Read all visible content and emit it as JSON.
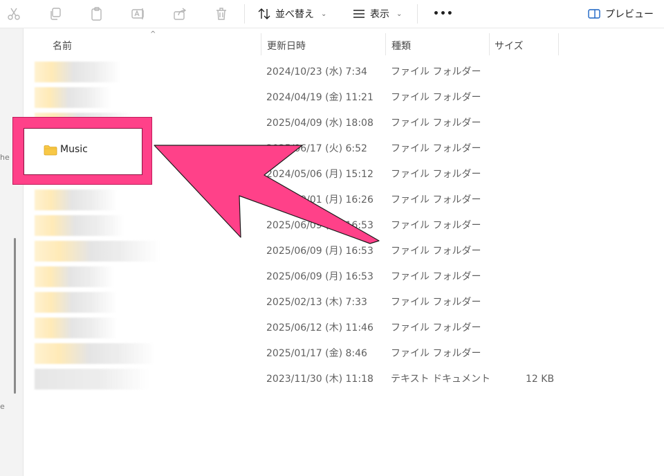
{
  "toolbar": {
    "sort_label": "並べ替え",
    "view_label": "表示",
    "more_label": "•••",
    "preview_label": "プレビュー"
  },
  "headers": {
    "name": "名前",
    "date": "更新日時",
    "type": "種類",
    "size": "サイズ"
  },
  "rows": [
    {
      "date": "2024/10/23 (水) 7:34",
      "type": "ファイル フォルダー",
      "size": ""
    },
    {
      "date": "2024/04/19 (金) 11:21",
      "type": "ファイル フォルダー",
      "size": ""
    },
    {
      "date": "2025/04/09 (水) 18:08",
      "type": "ファイル フォルダー",
      "size": ""
    },
    {
      "date": "2025/06/17 (火) 6:52",
      "type": "ファイル フォルダー",
      "size": ""
    },
    {
      "date": "2024/05/06 (月) 15:12",
      "type": "ファイル フォルダー",
      "size": ""
    },
    {
      "date": "2024/09/01 (月) 16:26",
      "type": "ファイル フォルダー",
      "size": ""
    },
    {
      "date": "2025/06/09 (月) 16:53",
      "type": "ファイル フォルダー",
      "size": ""
    },
    {
      "date": "2025/06/09 (月) 16:53",
      "type": "ファイル フォルダー",
      "size": ""
    },
    {
      "date": "2025/06/09 (月) 16:53",
      "type": "ファイル フォルダー",
      "size": ""
    },
    {
      "date": "2025/02/13 (木) 7:33",
      "type": "ファイル フォルダー",
      "size": ""
    },
    {
      "date": "2025/06/12 (木) 11:46",
      "type": "ファイル フォルダー",
      "size": ""
    },
    {
      "date": "2025/01/17 (金) 8:46",
      "type": "ファイル フォルダー",
      "size": ""
    },
    {
      "date": "2023/11/30 (木) 11:18",
      "type": "テキスト ドキュメント",
      "size": "12 KB"
    }
  ],
  "callout": {
    "label": "Music"
  },
  "nav": {
    "frag1": "he",
    "frag2": "e"
  },
  "colors": {
    "callout": "#ff4189",
    "folder": "#f8c846"
  }
}
